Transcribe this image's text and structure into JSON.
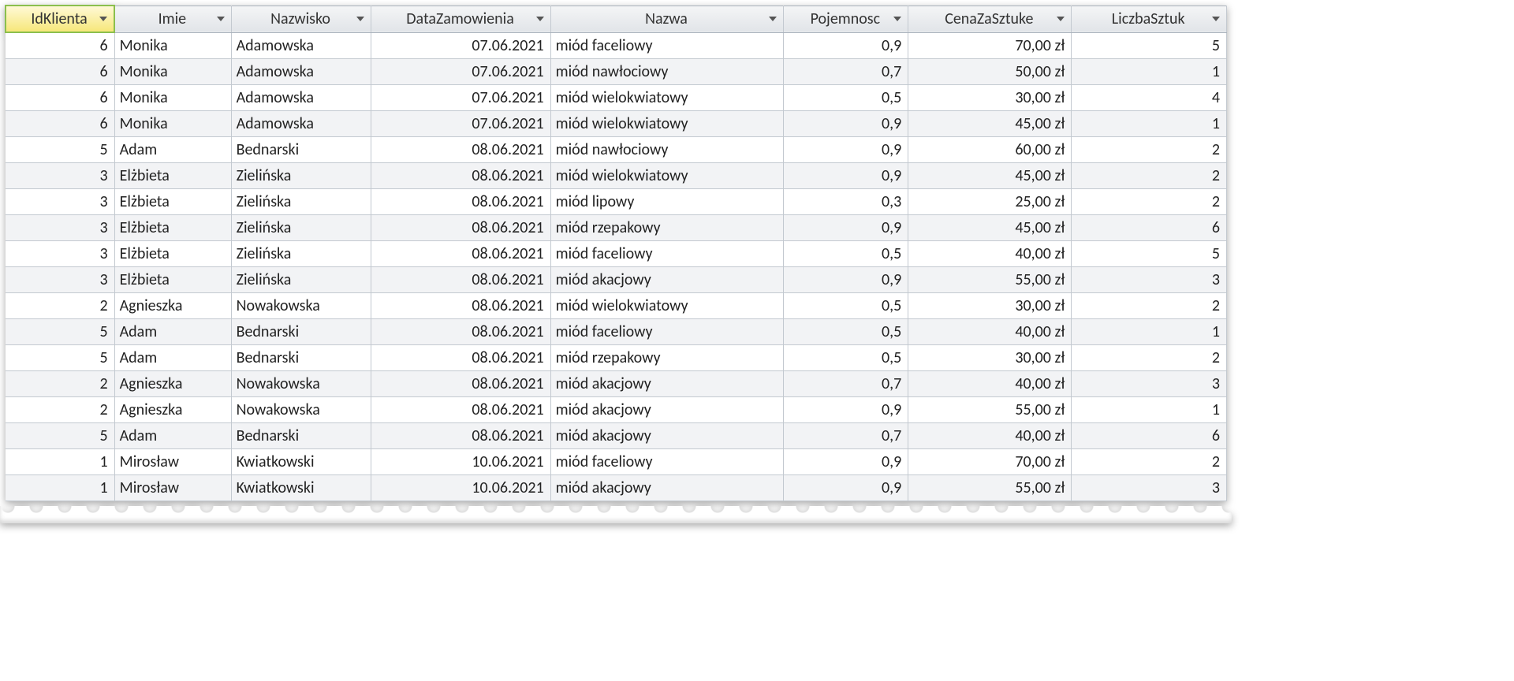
{
  "columns": [
    {
      "key": "id",
      "label": "IdKlienta",
      "cls": "col-id",
      "active": true
    },
    {
      "key": "imie",
      "label": "Imie",
      "cls": "col-imie",
      "active": false
    },
    {
      "key": "nazwisko",
      "label": "Nazwisko",
      "cls": "col-nazw",
      "active": false
    },
    {
      "key": "data",
      "label": "DataZamowienia",
      "cls": "col-data",
      "active": false
    },
    {
      "key": "nazwa",
      "label": "Nazwa",
      "cls": "col-nazwa",
      "active": false
    },
    {
      "key": "poj",
      "label": "Pojemnosc",
      "cls": "col-poj",
      "active": false
    },
    {
      "key": "cena",
      "label": "CenaZaSztuke",
      "cls": "col-cena",
      "active": false
    },
    {
      "key": "sztuk",
      "label": "LiczbaSztuk",
      "cls": "col-szt",
      "active": false
    }
  ],
  "rows": [
    {
      "id": "6",
      "imie": "Monika",
      "nazwisko": "Adamowska",
      "data": "07.06.2021",
      "nazwa": "miód faceliowy",
      "poj": "0,9",
      "cena": "70,00 zł",
      "sztuk": "5"
    },
    {
      "id": "6",
      "imie": "Monika",
      "nazwisko": "Adamowska",
      "data": "07.06.2021",
      "nazwa": "miód nawłociowy",
      "poj": "0,7",
      "cena": "50,00 zł",
      "sztuk": "1"
    },
    {
      "id": "6",
      "imie": "Monika",
      "nazwisko": "Adamowska",
      "data": "07.06.2021",
      "nazwa": "miód wielokwiatowy",
      "poj": "0,5",
      "cena": "30,00 zł",
      "sztuk": "4"
    },
    {
      "id": "6",
      "imie": "Monika",
      "nazwisko": "Adamowska",
      "data": "07.06.2021",
      "nazwa": "miód wielokwiatowy",
      "poj": "0,9",
      "cena": "45,00 zł",
      "sztuk": "1"
    },
    {
      "id": "5",
      "imie": "Adam",
      "nazwisko": "Bednarski",
      "data": "08.06.2021",
      "nazwa": "miód nawłociowy",
      "poj": "0,9",
      "cena": "60,00 zł",
      "sztuk": "2"
    },
    {
      "id": "3",
      "imie": "Elżbieta",
      "nazwisko": "Zielińska",
      "data": "08.06.2021",
      "nazwa": "miód wielokwiatowy",
      "poj": "0,9",
      "cena": "45,00 zł",
      "sztuk": "2"
    },
    {
      "id": "3",
      "imie": "Elżbieta",
      "nazwisko": "Zielińska",
      "data": "08.06.2021",
      "nazwa": "miód lipowy",
      "poj": "0,3",
      "cena": "25,00 zł",
      "sztuk": "2"
    },
    {
      "id": "3",
      "imie": "Elżbieta",
      "nazwisko": "Zielińska",
      "data": "08.06.2021",
      "nazwa": "miód rzepakowy",
      "poj": "0,9",
      "cena": "45,00 zł",
      "sztuk": "6"
    },
    {
      "id": "3",
      "imie": "Elżbieta",
      "nazwisko": "Zielińska",
      "data": "08.06.2021",
      "nazwa": "miód faceliowy",
      "poj": "0,5",
      "cena": "40,00 zł",
      "sztuk": "5"
    },
    {
      "id": "3",
      "imie": "Elżbieta",
      "nazwisko": "Zielińska",
      "data": "08.06.2021",
      "nazwa": "miód akacjowy",
      "poj": "0,9",
      "cena": "55,00 zł",
      "sztuk": "3"
    },
    {
      "id": "2",
      "imie": "Agnieszka",
      "nazwisko": "Nowakowska",
      "data": "08.06.2021",
      "nazwa": "miód wielokwiatowy",
      "poj": "0,5",
      "cena": "30,00 zł",
      "sztuk": "2"
    },
    {
      "id": "5",
      "imie": "Adam",
      "nazwisko": "Bednarski",
      "data": "08.06.2021",
      "nazwa": "miód faceliowy",
      "poj": "0,5",
      "cena": "40,00 zł",
      "sztuk": "1"
    },
    {
      "id": "5",
      "imie": "Adam",
      "nazwisko": "Bednarski",
      "data": "08.06.2021",
      "nazwa": "miód rzepakowy",
      "poj": "0,5",
      "cena": "30,00 zł",
      "sztuk": "2"
    },
    {
      "id": "2",
      "imie": "Agnieszka",
      "nazwisko": "Nowakowska",
      "data": "08.06.2021",
      "nazwa": "miód akacjowy",
      "poj": "0,7",
      "cena": "40,00 zł",
      "sztuk": "3"
    },
    {
      "id": "2",
      "imie": "Agnieszka",
      "nazwisko": "Nowakowska",
      "data": "08.06.2021",
      "nazwa": "miód akacjowy",
      "poj": "0,9",
      "cena": "55,00 zł",
      "sztuk": "1"
    },
    {
      "id": "5",
      "imie": "Adam",
      "nazwisko": "Bednarski",
      "data": "08.06.2021",
      "nazwa": "miód akacjowy",
      "poj": "0,7",
      "cena": "40,00 zł",
      "sztuk": "6"
    },
    {
      "id": "1",
      "imie": "Mirosław",
      "nazwisko": "Kwiatkowski",
      "data": "10.06.2021",
      "nazwa": "miód faceliowy",
      "poj": "0,9",
      "cena": "70,00 zł",
      "sztuk": "2"
    },
    {
      "id": "1",
      "imie": "Mirosław",
      "nazwisko": "Kwiatkowski",
      "data": "10.06.2021",
      "nazwa": "miód akacjowy",
      "poj": "0,9",
      "cena": "55,00 zł",
      "sztuk": "3"
    }
  ],
  "icons": {
    "dropdown": "filter-dropdown-icon"
  }
}
